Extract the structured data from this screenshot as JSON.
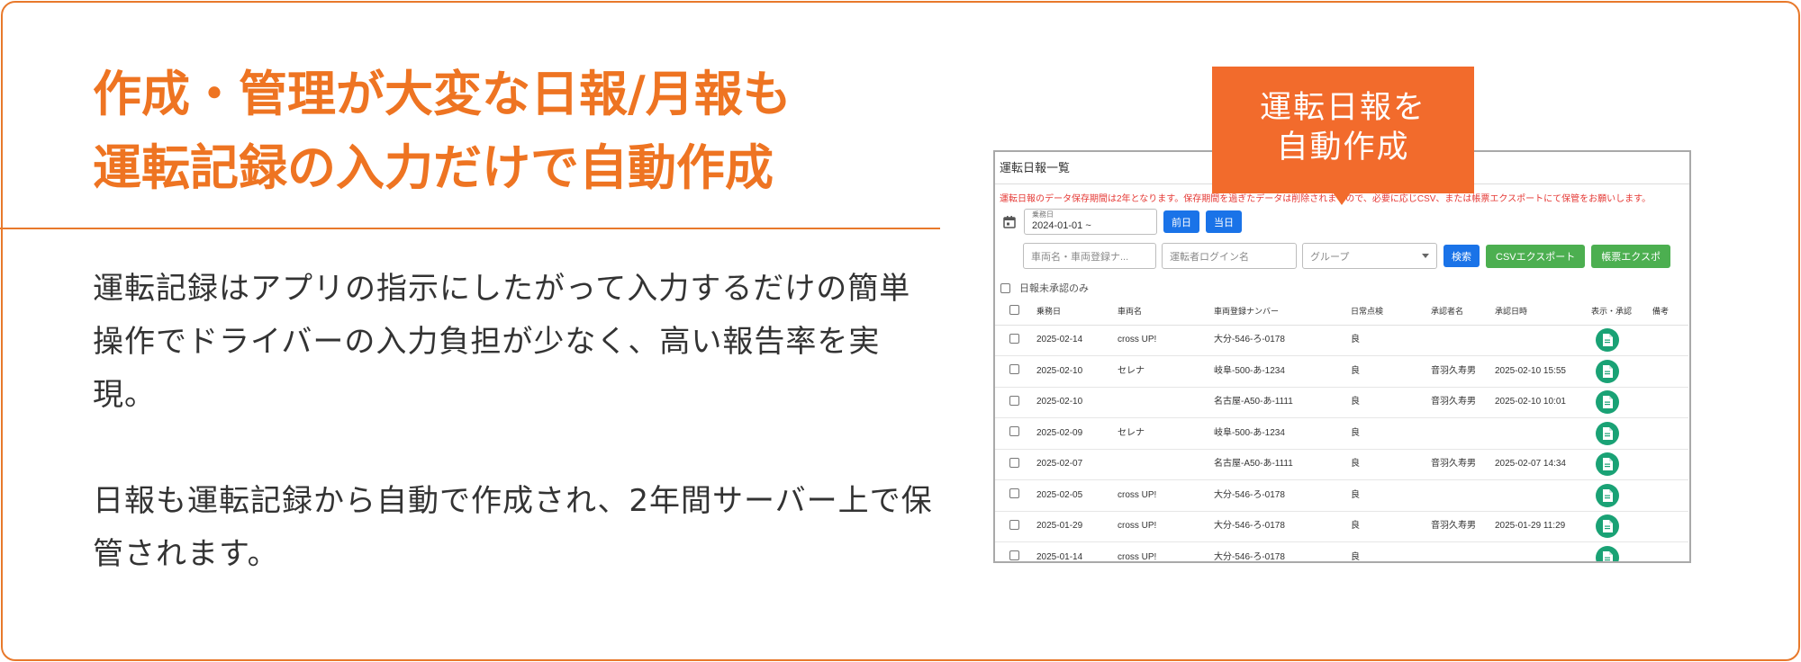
{
  "headline": {
    "line1": "作成・管理が大変な日報/月報も",
    "line2": "運転記録の入力だけで自動作成"
  },
  "body": {
    "paragraph1": "運転記録はアプリの指示にしたがって入力するだけの簡単操作でドライバーの入力負担が少なく、高い報告率を実現。",
    "paragraph2": "日報も運転記録から自動で作成され、2年間サーバー上で保管されます。"
  },
  "callout": {
    "line1": "運転日報を",
    "line2": "自動作成"
  },
  "screenshot": {
    "title": "運転日報一覧",
    "notice": "運転日報のデータ保存期間は2年となります。保存期間を過ぎたデータは削除されますので、必要に応じCSV、または帳票エクスポートにて保管をお願いします。",
    "date_label": "乗務日",
    "date_value": "2024-01-01 ~",
    "prev_day": "前日",
    "today": "当日",
    "vehicle_placeholder": "車両名・車両登録ナ...",
    "driver_placeholder": "運転者ログイン名",
    "group_placeholder": "グループ",
    "search": "検索",
    "csv_export": "CSVエクスポート",
    "form_export": "帳票エクスポ",
    "unconfirmed_only": "日報未承認のみ",
    "columns": [
      "乗務日",
      "車両名",
      "車両登録ナンバー",
      "日常点検",
      "承認者名",
      "承認日時",
      "表示・承認",
      "備考"
    ],
    "rows": [
      {
        "date": "2025-02-14",
        "name": "cross UP!",
        "plate": "大分-546-ろ-0178",
        "insp": "良",
        "approver": "",
        "approved_at": ""
      },
      {
        "date": "2025-02-10",
        "name": "セレナ",
        "plate": "岐阜-500-あ-1234",
        "insp": "良",
        "approver": "音羽久寿男",
        "approved_at": "2025-02-10 15:55"
      },
      {
        "date": "2025-02-10",
        "name": "",
        "plate": "名古屋-A50-あ-1111",
        "insp": "良",
        "approver": "音羽久寿男",
        "approved_at": "2025-02-10 10:01"
      },
      {
        "date": "2025-02-09",
        "name": "セレナ",
        "plate": "岐阜-500-あ-1234",
        "insp": "良",
        "approver": "",
        "approved_at": ""
      },
      {
        "date": "2025-02-07",
        "name": "",
        "plate": "名古屋-A50-あ-1111",
        "insp": "良",
        "approver": "音羽久寿男",
        "approved_at": "2025-02-07 14:34"
      },
      {
        "date": "2025-02-05",
        "name": "cross UP!",
        "plate": "大分-546-ろ-0178",
        "insp": "良",
        "approver": "",
        "approved_at": ""
      },
      {
        "date": "2025-01-29",
        "name": "cross UP!",
        "plate": "大分-546-ろ-0178",
        "insp": "良",
        "approver": "音羽久寿男",
        "approved_at": "2025-01-29 11:29"
      },
      {
        "date": "2025-01-14",
        "name": "cross UP!",
        "plate": "大分-546-ろ-0178",
        "insp": "良",
        "approver": "",
        "approved_at": ""
      }
    ]
  },
  "colors": {
    "accent": "#ee7422",
    "callout": "#f26b2c",
    "primary_button": "#1a73e8",
    "export_button": "#4caf50",
    "doc_button": "#1aa275",
    "notice": "#e53935"
  }
}
